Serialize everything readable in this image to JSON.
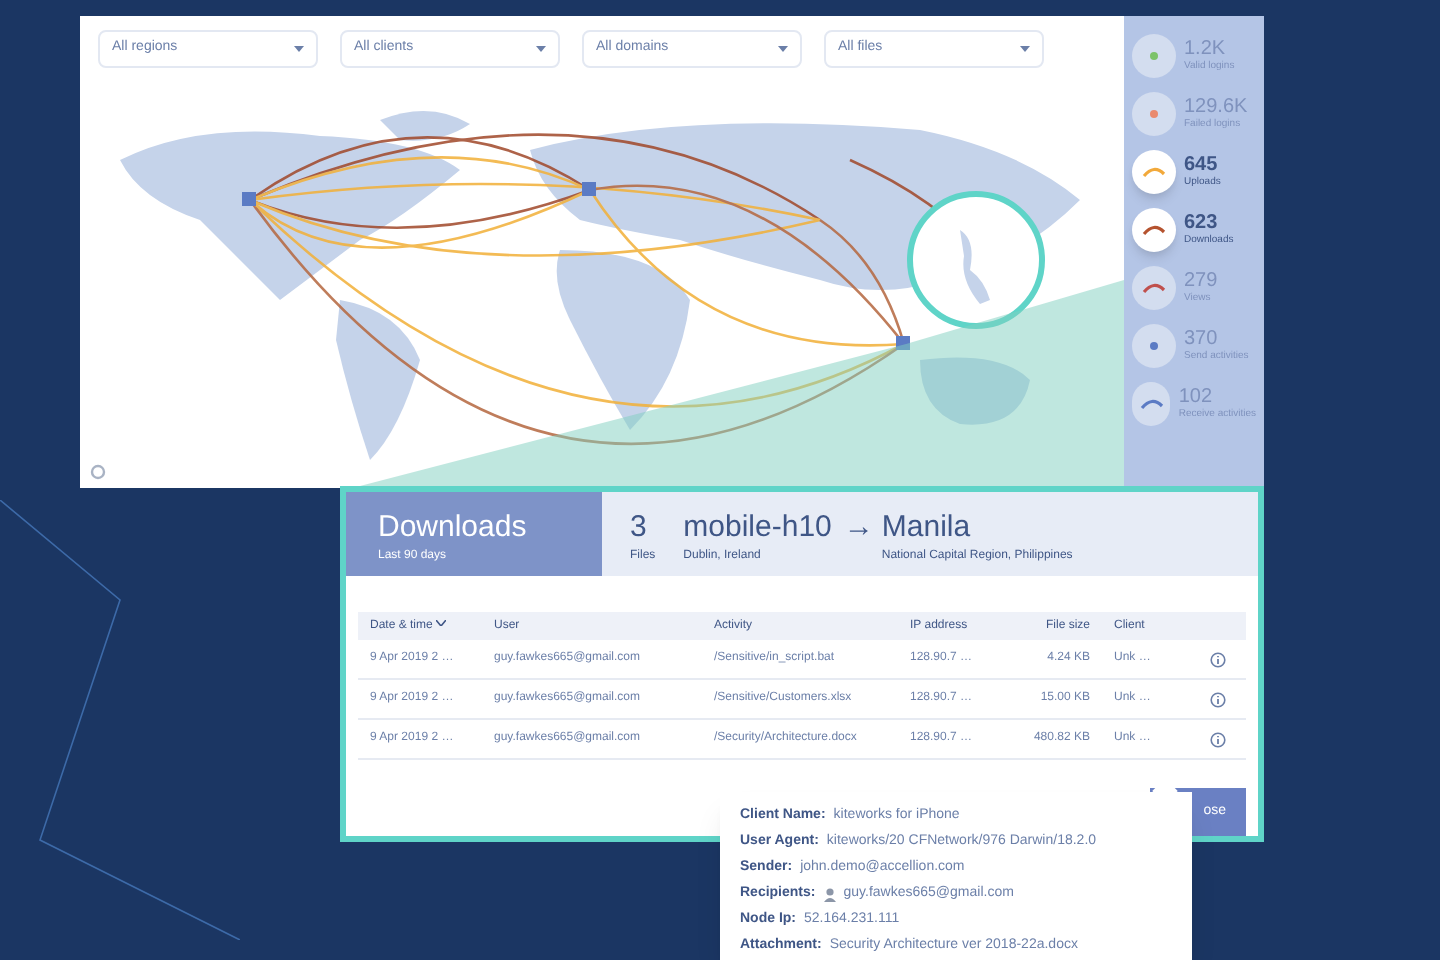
{
  "filters": [
    {
      "label": "All regions"
    },
    {
      "label": "All clients"
    },
    {
      "label": "All domains"
    },
    {
      "label": "All files"
    }
  ],
  "stats": [
    {
      "value": "1.2K",
      "label": "Valid logins",
      "kind": "dot",
      "color": "#7cc36a",
      "selected": false
    },
    {
      "value": "129.6K",
      "label": "Failed logins",
      "kind": "dot",
      "color": "#e98a6e",
      "selected": false
    },
    {
      "value": "645",
      "label": "Uploads",
      "kind": "arc",
      "color": "#f2a93b",
      "selected": true
    },
    {
      "value": "623",
      "label": "Downloads",
      "kind": "arc",
      "color": "#b5532f",
      "selected": true
    },
    {
      "value": "279",
      "label": "Views",
      "kind": "arc",
      "color": "#c0504d",
      "selected": false
    },
    {
      "value": "370",
      "label": "Send activities",
      "kind": "dot",
      "color": "#5b7bc4",
      "selected": false
    },
    {
      "value": "102",
      "label": "Receive activities",
      "kind": "arc",
      "color": "#5b7bc4",
      "selected": false
    }
  ],
  "detail": {
    "title": "Downloads",
    "subtitle": "Last 90 days",
    "count": "3",
    "count_label": "Files",
    "source": "mobile-h10",
    "source_place": "Dublin, Ireland",
    "arrow": "→",
    "destination": "Manila",
    "destination_place": "National Capital Region, Philippines",
    "columns": [
      "Date & time",
      "User",
      "Activity",
      "IP address",
      "File size",
      "Client"
    ],
    "rows": [
      [
        "9 Apr 2019 2 …",
        "guy.fawkes665@gmail.com",
        "/Sensitive/in_script.bat",
        "128.90.7 …",
        "4.24 KB",
        "Unk …"
      ],
      [
        "9 Apr 2019 2 …",
        "guy.fawkes665@gmail.com",
        "/Sensitive/Customers.xlsx",
        "128.90.7 …",
        "15.00 KB",
        "Unk …"
      ],
      [
        "9 Apr 2019 2 …",
        "guy.fawkes665@gmail.com",
        "/Security/Architecture.docx",
        "128.90.7 …",
        "480.82 KB",
        "Unk …"
      ]
    ],
    "close_button": "ose"
  },
  "tooltip": [
    {
      "label": "Client Name:",
      "value": "kiteworks for iPhone",
      "kind": "text"
    },
    {
      "label": "User Agent:",
      "value": "kiteworks/20 CFNetwork/976 Darwin/18.2.0",
      "kind": "text"
    },
    {
      "label": "Sender:",
      "value": "john.demo@accellion.com",
      "kind": "text"
    },
    {
      "label": "Recipients:",
      "value": "guy.fawkes665@gmail.com",
      "kind": "user"
    },
    {
      "label": "Node Ip:",
      "value": "52.164.231.111",
      "kind": "text"
    },
    {
      "label": "Attachment:",
      "value": "Security Architecture ver 2018-22a.docx",
      "kind": "text"
    }
  ]
}
